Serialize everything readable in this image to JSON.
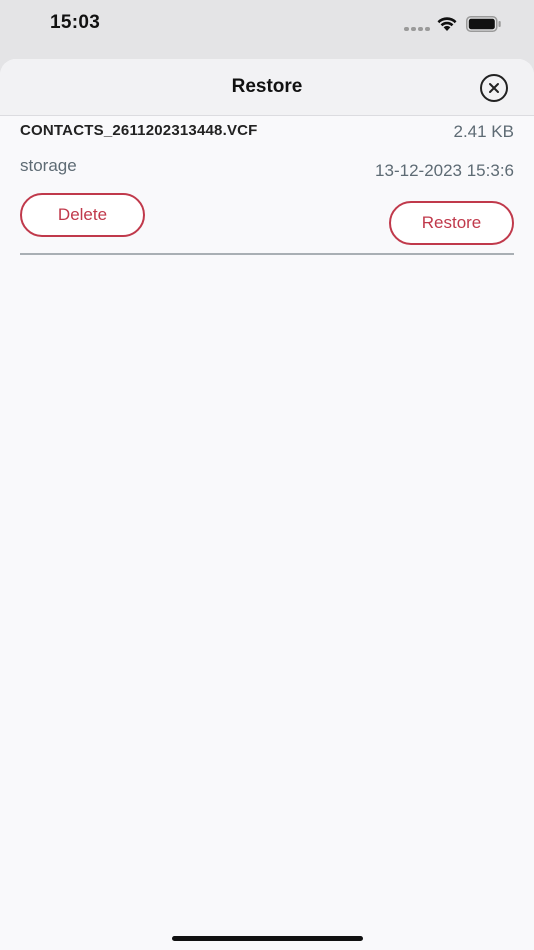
{
  "status_bar": {
    "time": "15:03"
  },
  "header": {
    "title": "Restore"
  },
  "backup_file": {
    "name": "CONTACTS_2611202313448.VCF",
    "size": "2.41 KB",
    "location": "storage",
    "date": "13-12-2023 15:3:6",
    "delete_label": "Delete",
    "restore_label": "Restore"
  },
  "colors": {
    "accent": "#c0394b",
    "secondary_text": "#5e6b74",
    "sheet_background": "#f9f9fb"
  }
}
